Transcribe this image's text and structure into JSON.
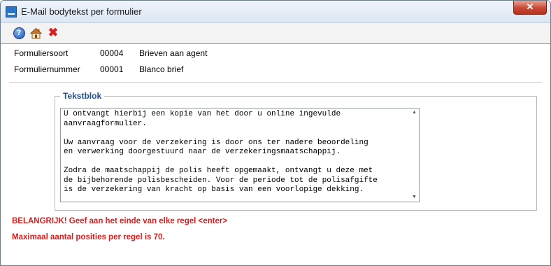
{
  "window": {
    "title": "E-Mail bodytekst per formulier",
    "close_label": "✕"
  },
  "toolbar": {
    "buttons": [
      {
        "icon": "help-icon",
        "glyph": "?"
      },
      {
        "icon": "home-icon"
      },
      {
        "icon": "delete-icon",
        "glyph": "✖"
      }
    ]
  },
  "form": {
    "formuliersoort": {
      "label": "Formuliersoort",
      "code": "00004",
      "description": "Brieven aan agent"
    },
    "formuliernummer": {
      "label": "Formuliernummer",
      "code": "00001",
      "description": "Blanco brief"
    }
  },
  "tekstblok": {
    "legend": "Tekstblok",
    "content": "U ontvangt hierbij een kopie van het door u online ingevulde\naanvraagformulier.\n\nUw aanvraag voor de verzekering is door ons ter nadere beoordeling\nen verwerking doorgestuurd naar de verzekeringsmaatschappij.\n\nZodra de maatschappij de polis heeft opgemaakt, ontvangt u deze met\nde bijbehorende polisbescheiden. Voor de periode tot de polisafgifte\nis de verzekering van kracht op basis van een voorlopige dekking.",
    "scroll_up": "▲",
    "scroll_down": "▼"
  },
  "warnings": {
    "line1": "BELANGRIJK! Geef aan het einde van elke regel <enter>",
    "line2": "Maximaal aantal posities per regel is 70."
  },
  "colors": {
    "warning": "#e01b1b",
    "legend": "#1f4f8f",
    "close_button": "#c74a36"
  }
}
